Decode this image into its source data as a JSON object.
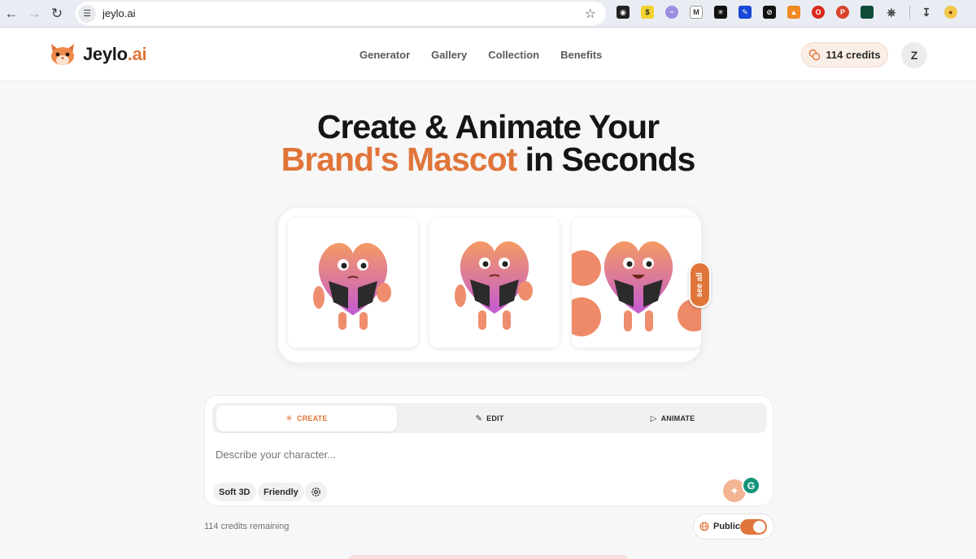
{
  "browser": {
    "url": "jeylo.ai",
    "icons": [
      "back-arrow-icon",
      "forward-arrow-icon",
      "reload-icon",
      "site-settings-icon",
      "bookmark-star-icon",
      "download-icon"
    ]
  },
  "header": {
    "logo_word": "Jeylo",
    "logo_suffix": ".ai",
    "nav": [
      "Generator",
      "Gallery",
      "Collection",
      "Benefits"
    ],
    "credits_label": "114 credits",
    "avatar_initial": "Z"
  },
  "hero": {
    "line1": "Create & Animate Your",
    "line2_accent": "Brand's Mascot",
    "line2_rest": " in Seconds"
  },
  "gallery": {
    "see_all": "see all"
  },
  "composer": {
    "tabs": [
      {
        "label": "CREATE",
        "active": true
      },
      {
        "label": "EDIT",
        "active": false
      },
      {
        "label": "ANIMATE",
        "active": false
      }
    ],
    "placeholder": "Describe your character...",
    "chips": [
      "Soft 3D",
      "Friendly"
    ]
  },
  "footer": {
    "credits_remaining": "114 credits remaining",
    "visibility_label": "Public",
    "public_on": true
  },
  "colors": {
    "accent": "#e0753a",
    "accent_soft": "#fbeee6"
  }
}
